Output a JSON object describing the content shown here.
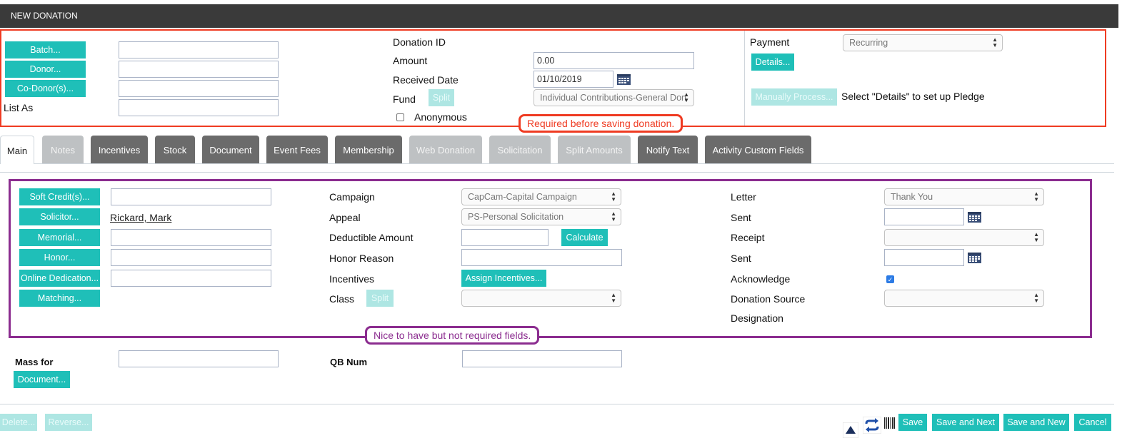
{
  "header": {
    "title": "NEW DONATION"
  },
  "top_left": {
    "batch_button": "Batch...",
    "donor_button": "Donor...",
    "codonor_button": "Co-Donor(s)...",
    "list_as_label": "List As"
  },
  "top_middle": {
    "donation_id_label": "Donation ID",
    "amount_label": "Amount",
    "amount_value": "0.00",
    "received_date_label": "Received Date",
    "received_date_value": "01/10/2019",
    "fund_label": "Fund",
    "fund_split_button": "Split",
    "fund_value": "Individual Contributions-General Don",
    "anonymous_label": "Anonymous"
  },
  "top_right": {
    "payment_label": "Payment",
    "payment_value": "Recurring",
    "details_button": "Details...",
    "manually_process_button": "Manually Process...",
    "pledge_message": "Select \"Details\" to set up Pledge"
  },
  "callouts": {
    "required": "Required before saving donation.",
    "optional": "Nice to have but not required fields."
  },
  "tabs": [
    {
      "label": "Main",
      "state": "active"
    },
    {
      "label": "Notes",
      "state": "disabled"
    },
    {
      "label": "Incentives",
      "state": "normal"
    },
    {
      "label": "Stock",
      "state": "normal"
    },
    {
      "label": "Document",
      "state": "normal"
    },
    {
      "label": "Event Fees",
      "state": "normal"
    },
    {
      "label": "Membership",
      "state": "normal"
    },
    {
      "label": "Web Donation",
      "state": "disabled"
    },
    {
      "label": "Solicitation",
      "state": "disabled"
    },
    {
      "label": "Split Amounts",
      "state": "disabled"
    },
    {
      "label": "Notify Text",
      "state": "normal"
    },
    {
      "label": "Activity Custom Fields",
      "state": "normal"
    }
  ],
  "main": {
    "soft_credits_button": "Soft Credit(s)...",
    "solicitor_button": "Solicitor...",
    "solicitor_value": "Rickard, Mark",
    "memorial_button": "Memorial...",
    "honor_button": "Honor...",
    "online_dedication_button": "Online Dedication...",
    "matching_button": "Matching...",
    "campaign_label": "Campaign",
    "campaign_value": "CapCam-Capital Campaign",
    "appeal_label": "Appeal",
    "appeal_value": "PS-Personal Solicitation",
    "deductible_label": "Deductible Amount",
    "calculate_button": "Calculate",
    "honor_reason_label": "Honor Reason",
    "incentives_label": "Incentives",
    "assign_incentives_button": "Assign Incentives...",
    "class_label": "Class",
    "class_split_button": "Split",
    "letter_label": "Letter",
    "letter_value": "Thank You",
    "sent_label": "Sent",
    "receipt_label": "Receipt",
    "sent2_label": "Sent",
    "acknowledge_label": "Acknowledge",
    "donation_source_label": "Donation Source",
    "designation_label": "Designation"
  },
  "lower": {
    "mass_for_label": "Mass for",
    "document_button": "Document...",
    "qb_num_label": "QB Num"
  },
  "footer": {
    "delete_button": "Delete...",
    "reverse_button": "Reverse...",
    "save_button": "Save",
    "save_next_button": "Save and Next",
    "save_new_button": "Save and New",
    "cancel_button": "Cancel"
  },
  "colors": {
    "teal": "#1fbfb8",
    "header_bg": "#3a3a3a",
    "required_callout": "#ef3b22",
    "optional_callout": "#8b2c8f"
  }
}
